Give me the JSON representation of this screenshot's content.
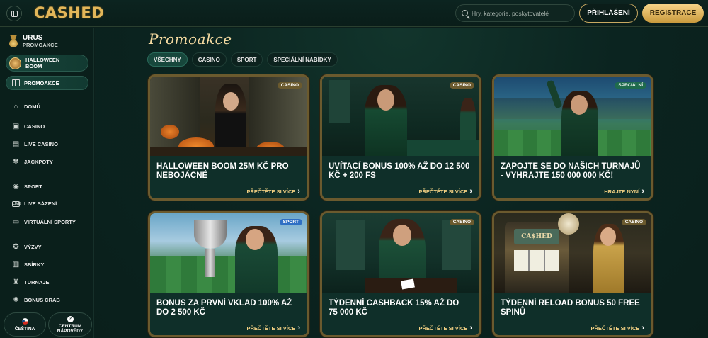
{
  "header": {
    "logo": "CASHED",
    "search_placeholder": "Hry, kategorie, poskytovatelé",
    "login_label": "PŘIHLÁŠENÍ",
    "register_label": "REGISTRACE"
  },
  "sidebar": {
    "user": {
      "name": "URUS",
      "sub": "PROMOAKCE"
    },
    "highlight": {
      "label_line1": "HALLOWEEN",
      "label_line2": "BOOM"
    },
    "promo_label": "PROMOAKCE",
    "items": [
      {
        "label": "DOMŮ",
        "icon": "home-icon"
      },
      {
        "label": "CASINO",
        "icon": "slot-icon"
      },
      {
        "label": "LIVE CASINO",
        "icon": "live-casino-icon"
      },
      {
        "label": "JACKPOTY",
        "icon": "jackpot-icon"
      },
      {
        "label": "SPORT",
        "icon": "ball-icon"
      },
      {
        "label": "LIVE SÁZENÍ",
        "icon": "live-icon"
      },
      {
        "label": "VIRTUÁLNÍ SPORTY",
        "icon": "monitor-icon"
      },
      {
        "label": "VÝZVY",
        "icon": "medal-icon"
      },
      {
        "label": "SBÍRKY",
        "icon": "book-icon"
      },
      {
        "label": "TURNAJE",
        "icon": "trophy-icon"
      },
      {
        "label": "BONUS CRAB",
        "icon": "crab-icon"
      }
    ],
    "language_label": "ČEŠTINA",
    "help_line1": "CENTRUM",
    "help_line2": "NÁPOVĚDY"
  },
  "main": {
    "title": "Promoakce",
    "filters": [
      "VŠECHNY",
      "CASINO",
      "SPORT",
      "SPECIÁLNÍ NABÍDKY"
    ],
    "cards": [
      {
        "badge": "CASINO",
        "badge_color": "#6b5a2e",
        "title": "HALLOWEEN BOOM 25M KČ PRO NEBOJÁCNÉ",
        "link": "PŘEČTĚTE SI VÍCE"
      },
      {
        "badge": "CASINO",
        "badge_color": "#6b5a2e",
        "title": "UVÍTACÍ BONUS 100% AŽ DO 12 500 KČ + 200 FS",
        "link": "PŘEČTĚTE SI VÍCE"
      },
      {
        "badge": "SPECIÁLNÍ",
        "badge_color": "#1f6b4c",
        "title": "ZAPOJTE SE DO NAŠICH TURNAJŮ - VYHRAJTE 150 000 000 KČ!",
        "link": "HRAJTE NYNÍ"
      },
      {
        "badge": "SPORT",
        "badge_color": "#2f6fc4",
        "title": "BONUS ZA PRVNÍ VKLAD 100% AŽ DO 2 500 KČ",
        "link": "PŘEČTĚTE SI VÍCE"
      },
      {
        "badge": "CASINO",
        "badge_color": "#6b5a2e",
        "title": "TÝDENNÍ CASHBACK 15% AŽ DO 75 000 KČ",
        "link": "PŘEČTĚTE SI VÍCE"
      },
      {
        "badge": "CASINO",
        "badge_color": "#6b5a2e",
        "title": "TÝDENNÍ RELOAD BONUS 50 FREE SPINŮ",
        "link": "PŘEČTĚTE SI VÍCE"
      }
    ]
  }
}
